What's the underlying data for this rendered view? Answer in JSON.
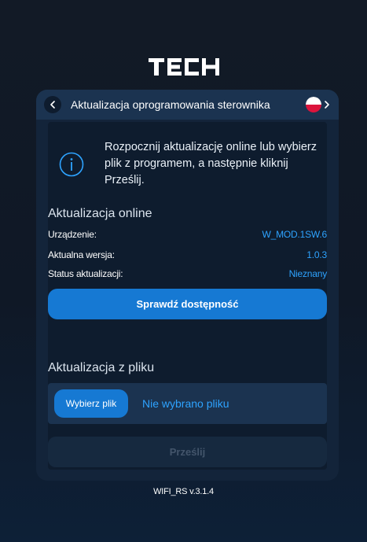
{
  "brand": {
    "logo_text": "TECH"
  },
  "header": {
    "title": "Aktualizacja oprogramowania sterownika",
    "language_flag": "pl-flag",
    "colors": {
      "flag_white": "#ffffff",
      "flag_red": "#dc143c"
    }
  },
  "info": {
    "icon": "info-icon",
    "text": "Rozpocznij aktualizację online lub wybierz plik z programem, a następnie kliknij Prześlij."
  },
  "online": {
    "title": "Aktualizacja online",
    "rows": [
      {
        "label": "Urządzenie:",
        "value": "W_MOD.1SW.6"
      },
      {
        "label": "Aktualna wersja:",
        "value": "1.0.3"
      },
      {
        "label": "Status aktualizacji:",
        "value": "Nieznany"
      }
    ],
    "check_button": "Sprawdź dostępność"
  },
  "file": {
    "title": "Aktualizacja z pliku",
    "choose_button": "Wybierz plik",
    "status": "Nie wybrano pliku",
    "send_button": "Prześlij"
  },
  "footer": {
    "version": "WIFI_RS v.3.1.4"
  },
  "colors": {
    "accent": "#1679d3",
    "link": "#2ea3ff",
    "card": "#13243a",
    "panel": "#0e1c2e"
  }
}
